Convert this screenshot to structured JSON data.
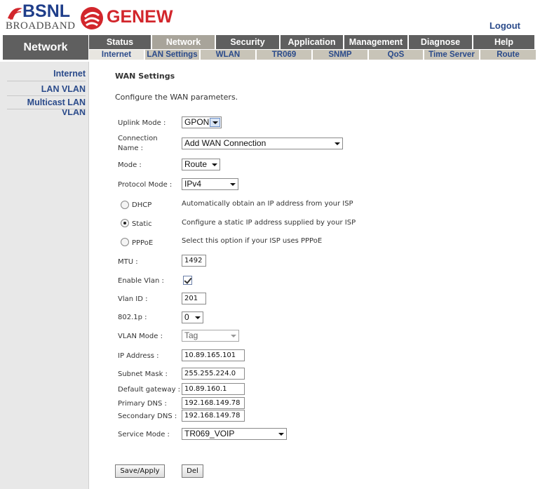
{
  "header": {
    "bsnl_logo": "BSNL",
    "broadband": "BROADBAND",
    "genew_logo": "GENEW",
    "logout": "Logout"
  },
  "nav": {
    "section_title": "Network",
    "main_tabs": [
      "Status",
      "Network",
      "Security",
      "Application",
      "Management",
      "Diagnose",
      "Help"
    ],
    "active_main_tab": "Network",
    "sub_tabs": [
      "Internet",
      "LAN Settings",
      "WLAN",
      "TR069",
      "SNMP",
      "QoS",
      "Time Server",
      "Route"
    ],
    "active_sub_tab": "Internet"
  },
  "sidebar": {
    "items": [
      "Internet",
      "LAN VLAN",
      "Multicast LAN",
      "VLAN"
    ]
  },
  "form": {
    "title": "WAN Settings",
    "intro": "Configure the WAN parameters.",
    "uplink_mode_label": "Uplink Mode :",
    "uplink_mode_value": "GPON",
    "connection_name_label_1": "Connection",
    "connection_name_label_2": "Name :",
    "connection_name_value": "Add WAN Connection",
    "mode_label": "Mode :",
    "mode_value": "Route",
    "protocol_mode_label": "Protocol Mode :",
    "protocol_mode_value": "IPv4",
    "dhcp_label": "DHCP",
    "dhcp_desc": "Automatically obtain an IP address from your ISP",
    "static_label": "Static",
    "static_desc": "Configure a static IP address supplied by your ISP",
    "pppoe_label": "PPPoE",
    "pppoe_desc": "Select this option if your ISP uses PPPoE",
    "selected_method": "Static",
    "mtu_label": "MTU :",
    "mtu_value": "1492",
    "enable_vlan_label": "Enable Vlan :",
    "enable_vlan_checked": true,
    "vlan_id_label": "Vlan ID :",
    "vlan_id_value": "201",
    "p8021_label": "802.1p :",
    "p8021_value": "0",
    "vlan_mode_label": "VLAN Mode :",
    "vlan_mode_value": "Tag",
    "ip_address_label": "IP Address :",
    "ip_address_value": "10.89.165.101",
    "subnet_mask_label": "Subnet Mask :",
    "subnet_mask_value": "255.255.224.0",
    "default_gateway_label": "Default gateway :",
    "default_gateway_value": "10.89.160.1",
    "primary_dns_label": "Primary DNS :",
    "primary_dns_value": "192.168.149.78",
    "secondary_dns_label": "Secondary DNS :",
    "secondary_dns_value": "192.168.149.78",
    "service_mode_label": "Service Mode :",
    "service_mode_value": "TR069_VOIP",
    "save_apply": "Save/Apply",
    "del": "Del"
  },
  "colors": {
    "nav_dark": "#5f5f5f",
    "nav_active": "#a8a49a",
    "subnav": "#c8c4b8",
    "link_blue": "#2a4a8a",
    "genew_red": "#d2262c",
    "bsnl_blue": "#1f3e8a"
  }
}
